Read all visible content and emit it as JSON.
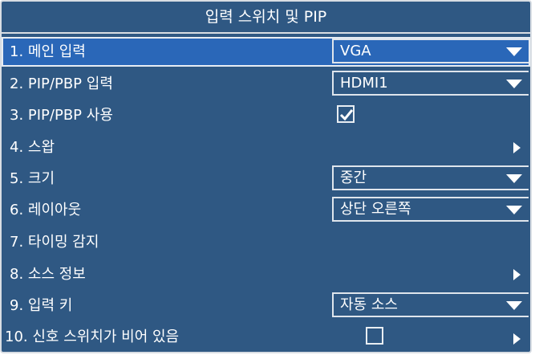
{
  "title": "입력 스위치 및 PIP",
  "items": [
    {
      "label": "1. 메인 입력",
      "control": "dropdown",
      "value": "VGA",
      "selected": true
    },
    {
      "label": "2. PIP/PBP 입력",
      "control": "dropdown",
      "value": "HDMI1"
    },
    {
      "label": "3. PIP/PBP 사용",
      "control": "checkbox",
      "checked": true
    },
    {
      "label": "4. 스왑",
      "control": "submenu"
    },
    {
      "label": "5. 크기",
      "control": "dropdown",
      "value": "중간"
    },
    {
      "label": "6. 레이아웃",
      "control": "dropdown",
      "value": "상단 오른쪽"
    },
    {
      "label": "7. 타이밍 감지",
      "control": "none"
    },
    {
      "label": "8. 소스 정보",
      "control": "submenu"
    },
    {
      "label": "9. 입력 키",
      "control": "dropdown",
      "value": "자동 소스"
    },
    {
      "label": "10. 신호 스위치가 비어 있음",
      "control": "checkbox+submenu",
      "checked": false
    }
  ],
  "colors": {
    "panel": "#2f5883",
    "selected": "#2a67b8",
    "border": "#d8dde3"
  }
}
